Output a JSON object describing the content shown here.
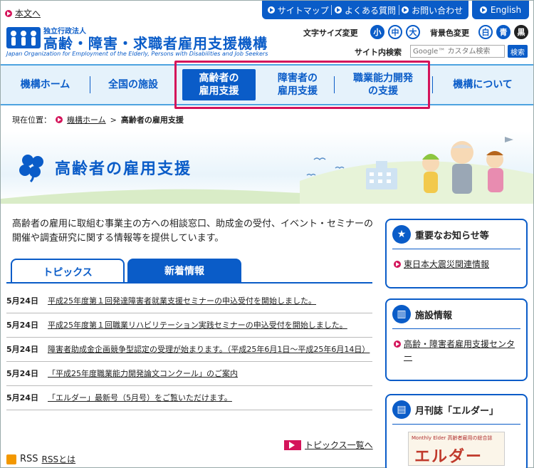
{
  "skip_link": "本文へ",
  "utility": {
    "sitemap": "サイトマップ",
    "faq": "よくある質問",
    "contact": "お問い合わせ",
    "english": "English"
  },
  "logo": {
    "sub": "独立行政法人",
    "main": "高齢・障害・求職者雇用支援機構",
    "en": "Japan Organization for Employment of the Elderly, Persons with Disabilities and Job Seekers"
  },
  "font_size": {
    "label": "文字サイズ変更",
    "small": "小",
    "medium": "中",
    "large": "大"
  },
  "bg_color": {
    "label": "背景色変更",
    "white": "白",
    "blue": "青",
    "black": "黒"
  },
  "search": {
    "label": "サイト内検索",
    "placeholder": "Google™ カスタム検索",
    "button": "検索"
  },
  "nav": [
    {
      "label": "機構ホーム"
    },
    {
      "label": "全国の施設"
    },
    {
      "label_l1": "高齢者の",
      "label_l2": "雇用支援"
    },
    {
      "label_l1": "障害者の",
      "label_l2": "雇用支援"
    },
    {
      "label_l1": "職業能力開発",
      "label_l2": "の支援"
    },
    {
      "label": "機構について"
    }
  ],
  "breadcrumb": {
    "label": "現在位置：",
    "home": "機構ホーム",
    "sep": ">",
    "current": "高齢者の雇用支援"
  },
  "banner_title": "高齢者の雇用支援",
  "intro": "高齢者の雇用に取組む事業主の方への相談窓口、助成金の受付、イベント・セミナーの開催や調査研究に関する情報等を提供しています。",
  "tabs": {
    "topics": "トピックス",
    "news": "新着情報"
  },
  "topics": [
    {
      "date": "5月24日",
      "text": "平成25年度第１回発達障害者就業支援セミナーの申込受付を開始しました。"
    },
    {
      "date": "5月24日",
      "text": "平成25年度第１回職業リハビリテーション実践セミナーの申込受付を開始しました。"
    },
    {
      "date": "5月24日",
      "text": "障害者助成金企画競争型認定の受理が始まります。（平成25年6月1日～平成25年6月14日）"
    },
    {
      "date": "5月24日",
      "text": "「平成25年度職業能力開発論文コンクール」のご案内"
    },
    {
      "date": "5月24日",
      "text": "「エルダー」最新号（5月号）をご覧いただけます。"
    }
  ],
  "more_topics": "トピックス一覧へ",
  "rss": {
    "label": "RSS",
    "about": "RSSとは"
  },
  "sidebar": {
    "important": {
      "title": "重要なお知らせ等",
      "link": "東日本大震災関連情報"
    },
    "facility": {
      "title": "施設情報",
      "link": "高齢・障害者雇用支援センター"
    },
    "magazine": {
      "title": "月刊誌「エルダー」",
      "cover_top": "Monthly Elder 高齢者雇用の総合誌",
      "cover_title": "エルダー"
    }
  },
  "colors": {
    "brand_blue": "#0a5cc8",
    "accent_pink": "#d4145a",
    "nav_bg": "#e5f2fb"
  }
}
